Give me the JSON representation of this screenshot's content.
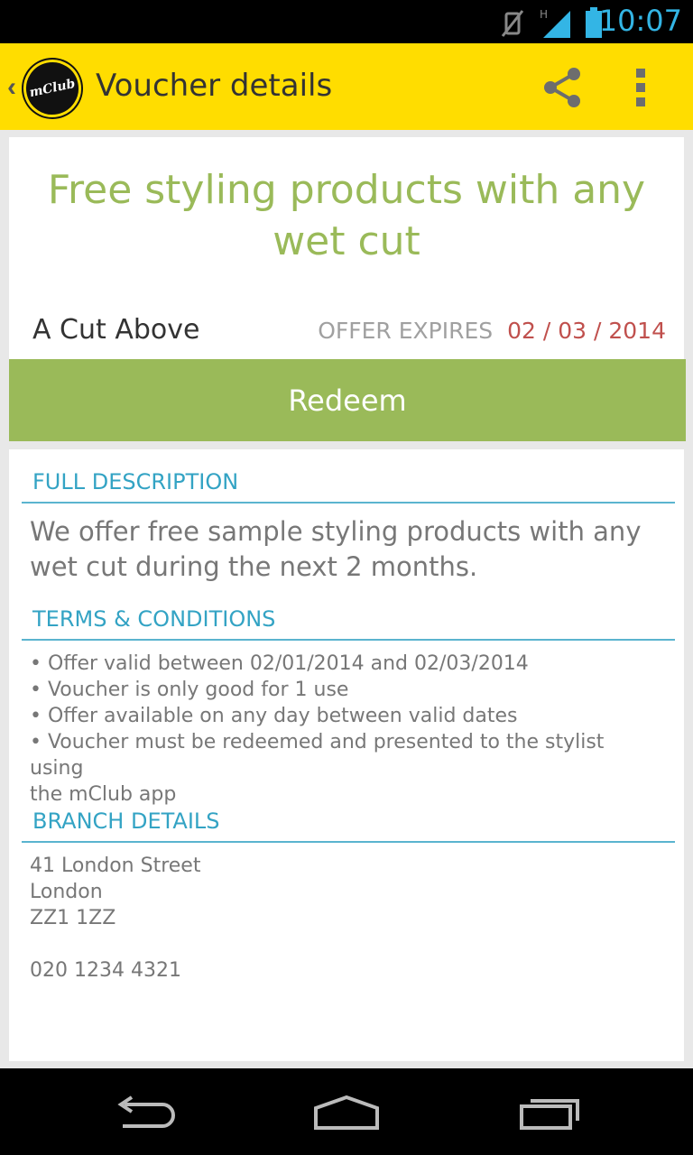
{
  "status_bar": {
    "time": "10:07",
    "icons": [
      "vibrate-mute-icon",
      "signal-h-icon",
      "battery-icon"
    ]
  },
  "action_bar": {
    "logo_text": "mClub",
    "title": "Voucher details",
    "actions": [
      "share-icon",
      "overflow-menu-icon"
    ]
  },
  "offer": {
    "title_line1": "Free styling products with any",
    "title_line2": "wet cut",
    "merchant": "A Cut Above",
    "expires_label": "OFFER EXPIRES",
    "expires_date": "02 / 03 / 2014"
  },
  "redeem_label": "Redeem",
  "description": {
    "header": "FULL DESCRIPTION",
    "line1": "We offer free sample styling products with any",
    "line2": "wet cut during the next 2 months."
  },
  "terms": {
    "header": "TERMS & CONDITIONS",
    "items": [
      "• Offer valid between 02/01/2014 and 02/03/2014",
      "• Voucher is only good for 1 use",
      "• Offer available on any day between valid dates",
      "• Voucher must be redeemed and presented to the stylist using",
      "the mClub app"
    ]
  },
  "branch": {
    "header": "BRANCH DETAILS",
    "address_line1": "41 London Street",
    "address_line2": "London",
    "postcode": "ZZ1 1ZZ",
    "phone": "020 1234 4321"
  },
  "colors": {
    "action_bar": "#ffdd00",
    "accent_green": "#9aba59",
    "section_blue": "#33a3c4",
    "expiry_red": "#c0504d"
  }
}
